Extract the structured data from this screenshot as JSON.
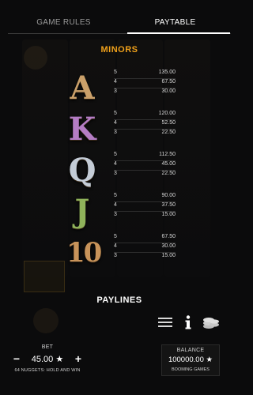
{
  "tabs": [
    {
      "label": "GAME RULES",
      "active": false
    },
    {
      "label": "PAYTABLE",
      "active": true
    }
  ],
  "minors_title": "MINORS",
  "symbols": [
    {
      "symbol": "A",
      "color": "#caa06a",
      "pays": [
        {
          "count": "5",
          "value": "135.00"
        },
        {
          "count": "4",
          "value": "67.50"
        },
        {
          "count": "3",
          "value": "30.00"
        }
      ]
    },
    {
      "symbol": "K",
      "color": "#b47cc4",
      "pays": [
        {
          "count": "5",
          "value": "120.00"
        },
        {
          "count": "4",
          "value": "52.50"
        },
        {
          "count": "3",
          "value": "22.50"
        }
      ]
    },
    {
      "symbol": "Q",
      "color": "#c4ccd6",
      "pays": [
        {
          "count": "5",
          "value": "112.50"
        },
        {
          "count": "4",
          "value": "45.00"
        },
        {
          "count": "3",
          "value": "22.50"
        }
      ]
    },
    {
      "symbol": "J",
      "color": "#8fb25a",
      "pays": [
        {
          "count": "5",
          "value": "90.00"
        },
        {
          "count": "4",
          "value": "37.50"
        },
        {
          "count": "3",
          "value": "15.00"
        }
      ]
    },
    {
      "symbol": "10",
      "color": "#c8935a",
      "pays": [
        {
          "count": "5",
          "value": "67.50"
        },
        {
          "count": "4",
          "value": "30.00"
        },
        {
          "count": "3",
          "value": "15.00"
        }
      ]
    }
  ],
  "paylines_title": "PAYLINES",
  "icons": {
    "menu": "menu-icon",
    "info": "info-icon",
    "coins": "coin-stack-icon"
  },
  "footer": {
    "bet_label": "BET",
    "bet_value": "45.00 ★",
    "minus": "−",
    "plus": "+",
    "bet_sub": "64 NUGGETS: HOLD AND WIN",
    "balance_label": "BALANCE",
    "balance_value": "100000.00 ★",
    "balance_sub": "BOOMING GAMES"
  },
  "colors": {
    "accent": "#f0a11a",
    "background": "#0b0b0c"
  }
}
